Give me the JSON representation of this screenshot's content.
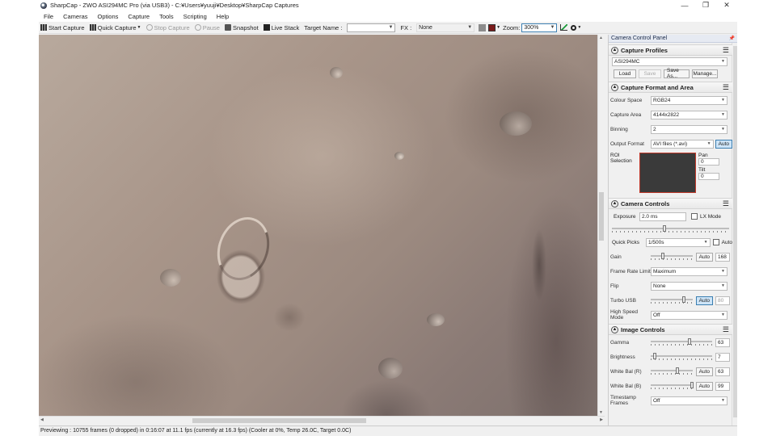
{
  "window": {
    "title": "SharpCap - ZWO ASI294MC Pro (via USB3) - C:¥Users¥yuuji¥Desktop¥SharpCap Captures",
    "minimize": "—",
    "maximize": "❐",
    "close": "✕"
  },
  "menu": [
    "File",
    "Cameras",
    "Options",
    "Capture",
    "Tools",
    "Scripting",
    "Help"
  ],
  "toolbar": {
    "start_capture": "Start Capture",
    "quick_capture": "Quick Capture",
    "stop_capture": "Stop Capture",
    "pause": "Pause",
    "snapshot": "Snapshot",
    "live_stack": "Live Stack",
    "target_name_label": "Target Name :",
    "target_name_value": "",
    "fx_label": "FX :",
    "fx_value": "None",
    "zoom_label": "Zoom:",
    "zoom_value": "300%"
  },
  "status": "Previewing : 10755 frames (0 dropped) in 0:16:07 at 11.1 fps  (currently at 16.3 fps) (Cooler at 0%, Temp 26.0C, Target 0.0C)",
  "panel": {
    "title": "Camera Control Panel",
    "capture_profiles": {
      "title": "Capture Profiles",
      "profile": "ASI294MC",
      "load": "Load",
      "save": "Save",
      "save_as": "Save As...",
      "manage": "Manage..."
    },
    "format_area": {
      "title": "Capture Format and Area",
      "colour_space_label": "Colour Space",
      "colour_space": "RGB24",
      "capture_area_label": "Capture Area",
      "capture_area": "4144x2822",
      "binning_label": "Binning",
      "binning": "2",
      "output_format_label": "Output Format",
      "output_format": "AVI files (*.avi)",
      "auto": "Auto",
      "roi_label": "ROI Selection",
      "pan_label": "Pan",
      "pan_value": "0",
      "tilt_label": "Tilt",
      "tilt_value": "0"
    },
    "camera_controls": {
      "title": "Camera Controls",
      "exposure_label": "Exposure",
      "exposure_value": "2.0 ms",
      "lx_mode": "LX Mode",
      "quick_picks_label": "Quick Picks",
      "quick_picks_value": "1/500s",
      "auto": "Auto",
      "gain_label": "Gain",
      "gain_value": "168",
      "frame_rate_label": "Frame Rate Limit",
      "frame_rate_value": "Maximum",
      "flip_label": "Flip",
      "flip_value": "None",
      "turbo_label": "Turbo USB",
      "turbo_value": "80",
      "high_speed_label": "High Speed Mode",
      "high_speed_value": "Off"
    },
    "image_controls": {
      "title": "Image Controls",
      "gamma_label": "Gamma",
      "gamma_value": "63",
      "brightness_label": "Brightness",
      "brightness_value": "7",
      "wb_r_label": "White Bal (R)",
      "wb_r_value": "63",
      "wb_b_label": "White Bal (B)",
      "wb_b_value": "99",
      "timestamp_label": "Timestamp Frames",
      "timestamp_value": "Off",
      "auto": "Auto"
    }
  },
  "sliders": {
    "exposure": 0.45,
    "gain": 0.3,
    "turbo": 0.8,
    "gamma": 0.63,
    "brightness": 0.07,
    "wb_r": 0.63,
    "wb_b": 0.99
  },
  "colors": {
    "accent": "#3c7fb1",
    "roi_border": "#c0392b",
    "roi_fill": "#3a3a3a"
  }
}
